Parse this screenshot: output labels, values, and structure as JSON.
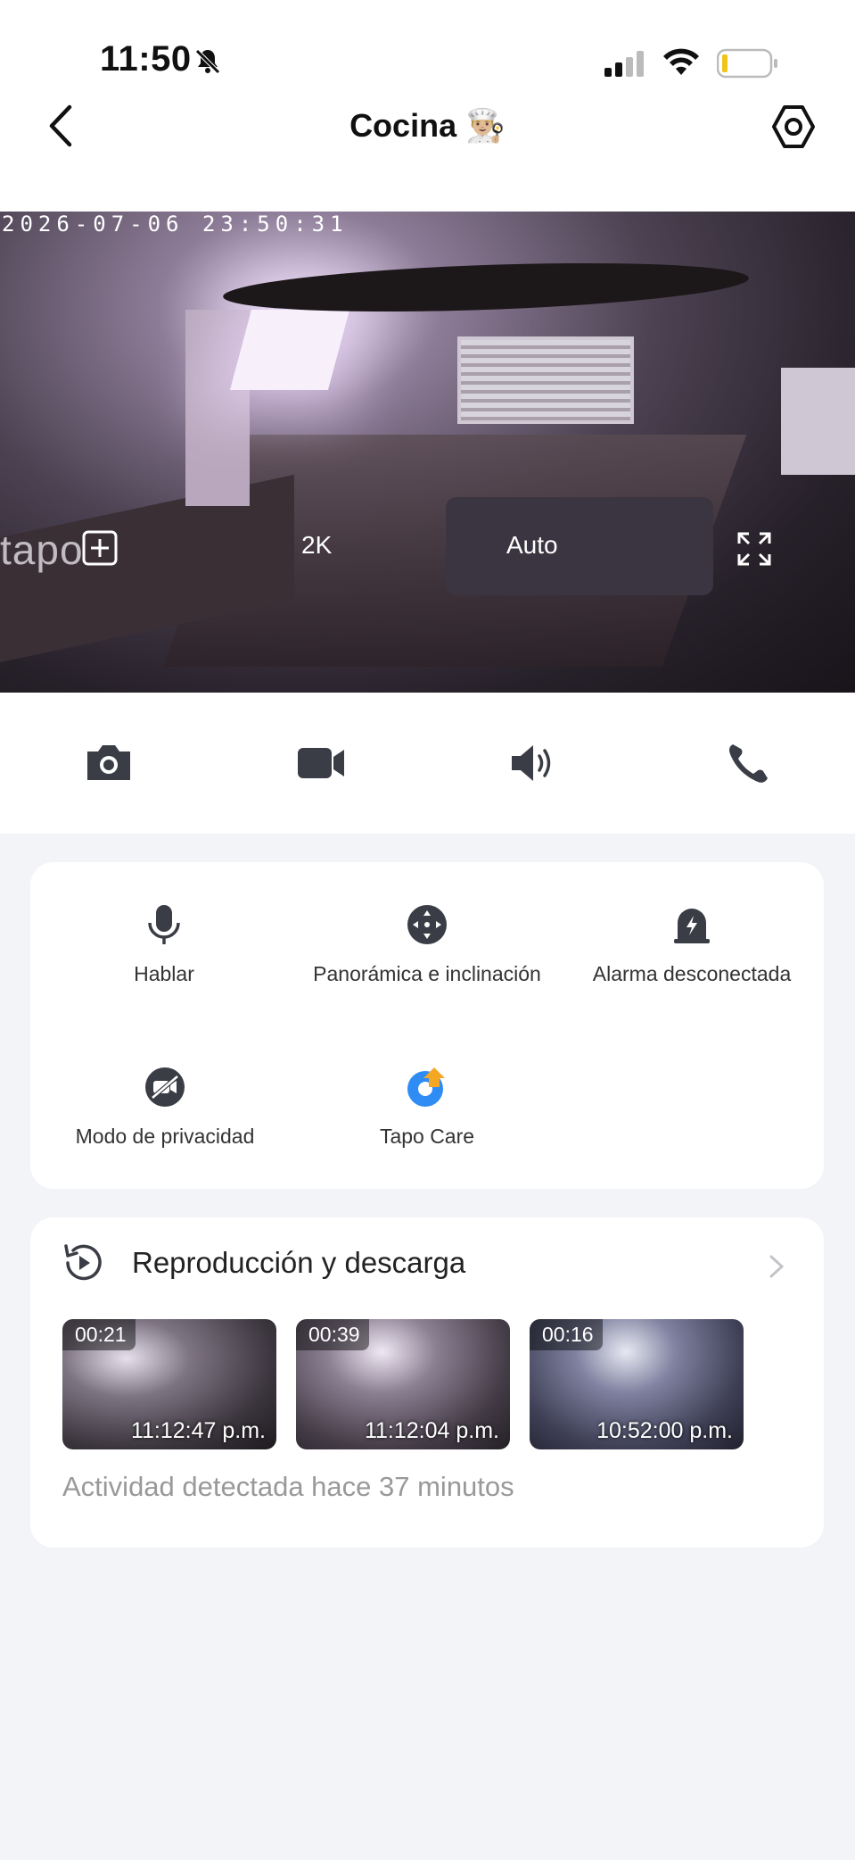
{
  "status_bar": {
    "time": "11:50"
  },
  "header": {
    "title": "Cocina 👨🏼‍🍳"
  },
  "feed": {
    "timestamp": "2026-07-06 23:50:31",
    "logo": "tapo",
    "resolution": "2K",
    "mode": "Auto"
  },
  "toolbar": {
    "items": [
      "camera-snapshot",
      "record-video",
      "speaker",
      "call"
    ]
  },
  "features": [
    {
      "label": "Hablar",
      "icon": "microphone-icon"
    },
    {
      "label": "Panorámica e inclinación",
      "icon": "pan-tilt-icon"
    },
    {
      "label": "Alarma desconectada",
      "icon": "alarm-icon"
    },
    {
      "label": "Modo de privacidad",
      "icon": "privacy-icon"
    },
    {
      "label": "Tapo Care",
      "icon": "tapo-care-icon"
    }
  ],
  "playback": {
    "title": "Reproducción y descarga",
    "clips": [
      {
        "duration": "00:21",
        "time": "11:12:47 p.m."
      },
      {
        "duration": "00:39",
        "time": "11:12:04 p.m."
      },
      {
        "duration": "00:16",
        "time": "10:52:00 p.m."
      }
    ],
    "activity": "Actividad detectada hace 37 minutos"
  },
  "colors": {
    "accent": "#2f8cf5",
    "care_orange": "#f5a623",
    "icon_dark": "#3a3d45"
  }
}
